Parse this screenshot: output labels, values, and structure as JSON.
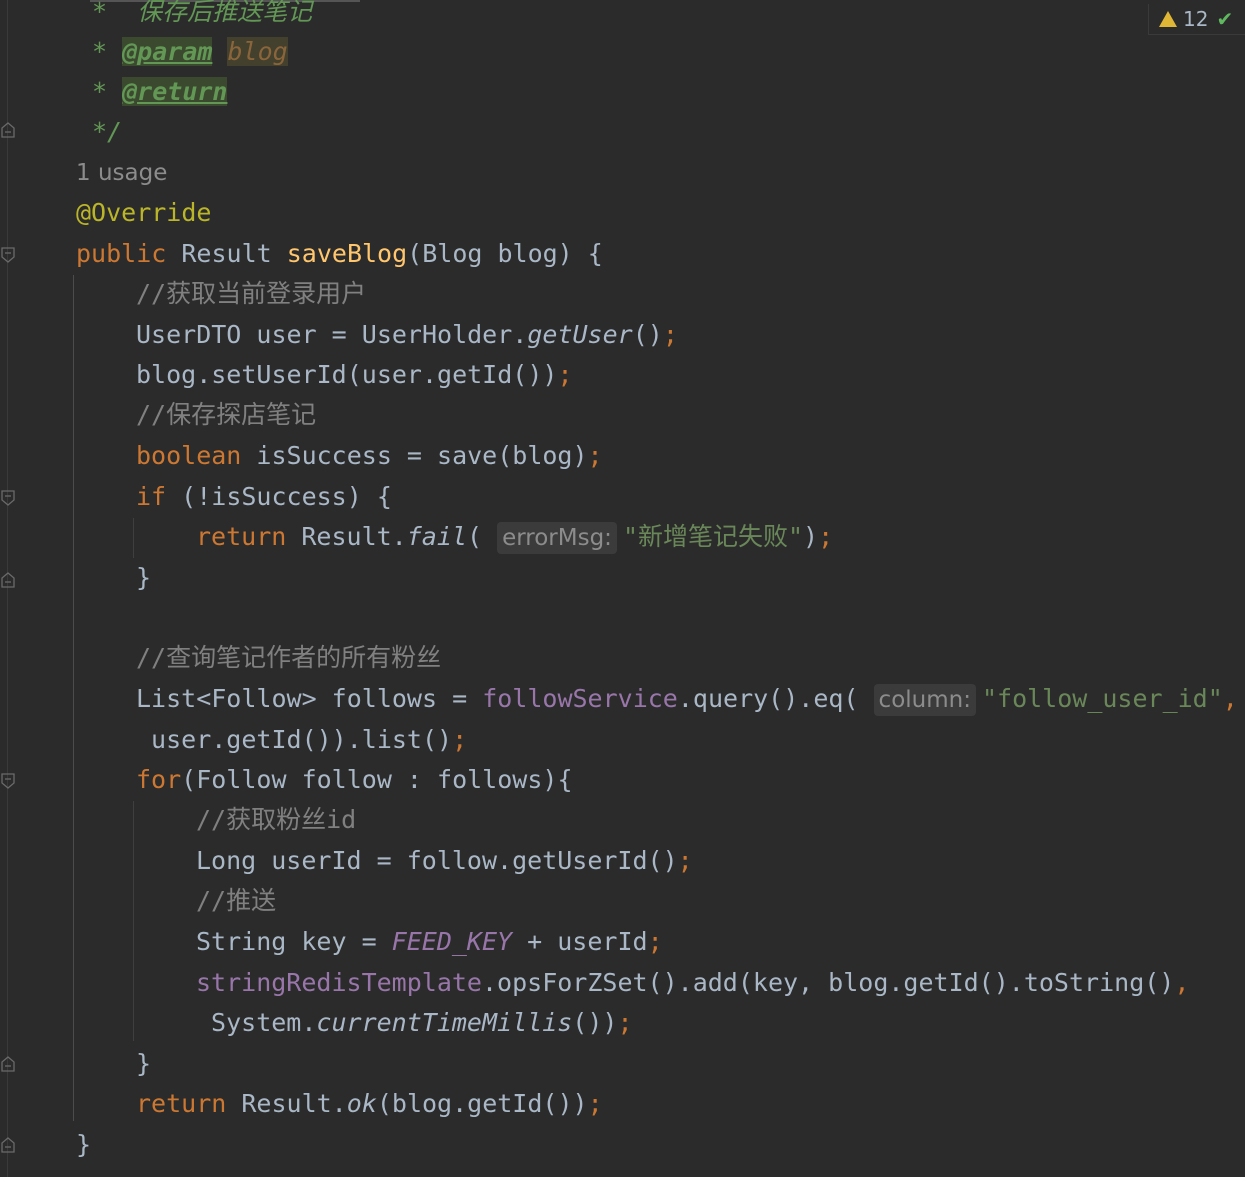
{
  "status": {
    "warning_count": "12"
  },
  "code": {
    "doc_summary": "*  保存后推送笔记",
    "doc_star": "* ",
    "doc_param_tag": "@param",
    "doc_param_name": "blog",
    "doc_return_tag": "@return",
    "doc_end": "*/",
    "usage": "1 usage",
    "annotation": "@Override",
    "kw_public": "public",
    "type_result": "Result",
    "method_name": "saveBlog",
    "signature_rest": "(Blog blog) {",
    "c_get_user": "//获取当前登录用户",
    "l_userdto": "UserDTO user = UserHolder.",
    "m_getuser": "getUser",
    "l_paren_close": "()",
    "semi": ";",
    "l_setuserid": "blog.setUserId(user.getId())",
    "c_save": "//保存探店笔记",
    "kw_boolean": "boolean",
    "l_issuccess": " isSuccess = save(blog)",
    "kw_if": "if",
    "l_if_cond": " (!isSuccess) {",
    "kw_return": "return",
    "l_result_dot": " Result.",
    "m_fail": "fail",
    "l_open": "(",
    "hint_errormsg": "errorMsg:",
    "s_fail_msg": "\"新增笔记失败\"",
    "l_close_paren": ")",
    "brace_close": "}",
    "c_query_fans": "//查询笔记作者的所有粉丝",
    "l_list_follow": "List<Follow> follows = ",
    "f_followservice": "followService",
    "l_query_eq": ".query().eq(",
    "hint_column": "column:",
    "s_follow_user_id": "\"follow_user_id\"",
    "comma": ",",
    "l_user_getid_list": " user.getId()).list()",
    "kw_for": "for",
    "l_for_rest": "(Follow follow : follows){",
    "c_get_fan_id": "//获取粉丝id",
    "l_long_userid": "Long userId = follow.getUserId()",
    "c_push": "//推送",
    "l_string_key": "String key = ",
    "cst_feed_key": "FEED_KEY",
    "l_plus_userid": " + userId",
    "f_redis": "stringRedisTemplate",
    "l_zset_add": ".opsForZSet().add(key, blog.getId().toString()",
    "l_system": " System.",
    "m_currenttime": "currentTimeMillis",
    "l_close_double": "())",
    "l_result_ok_pre": " Result.",
    "m_ok": "ok",
    "l_ok_args": "(blog.getId())"
  }
}
